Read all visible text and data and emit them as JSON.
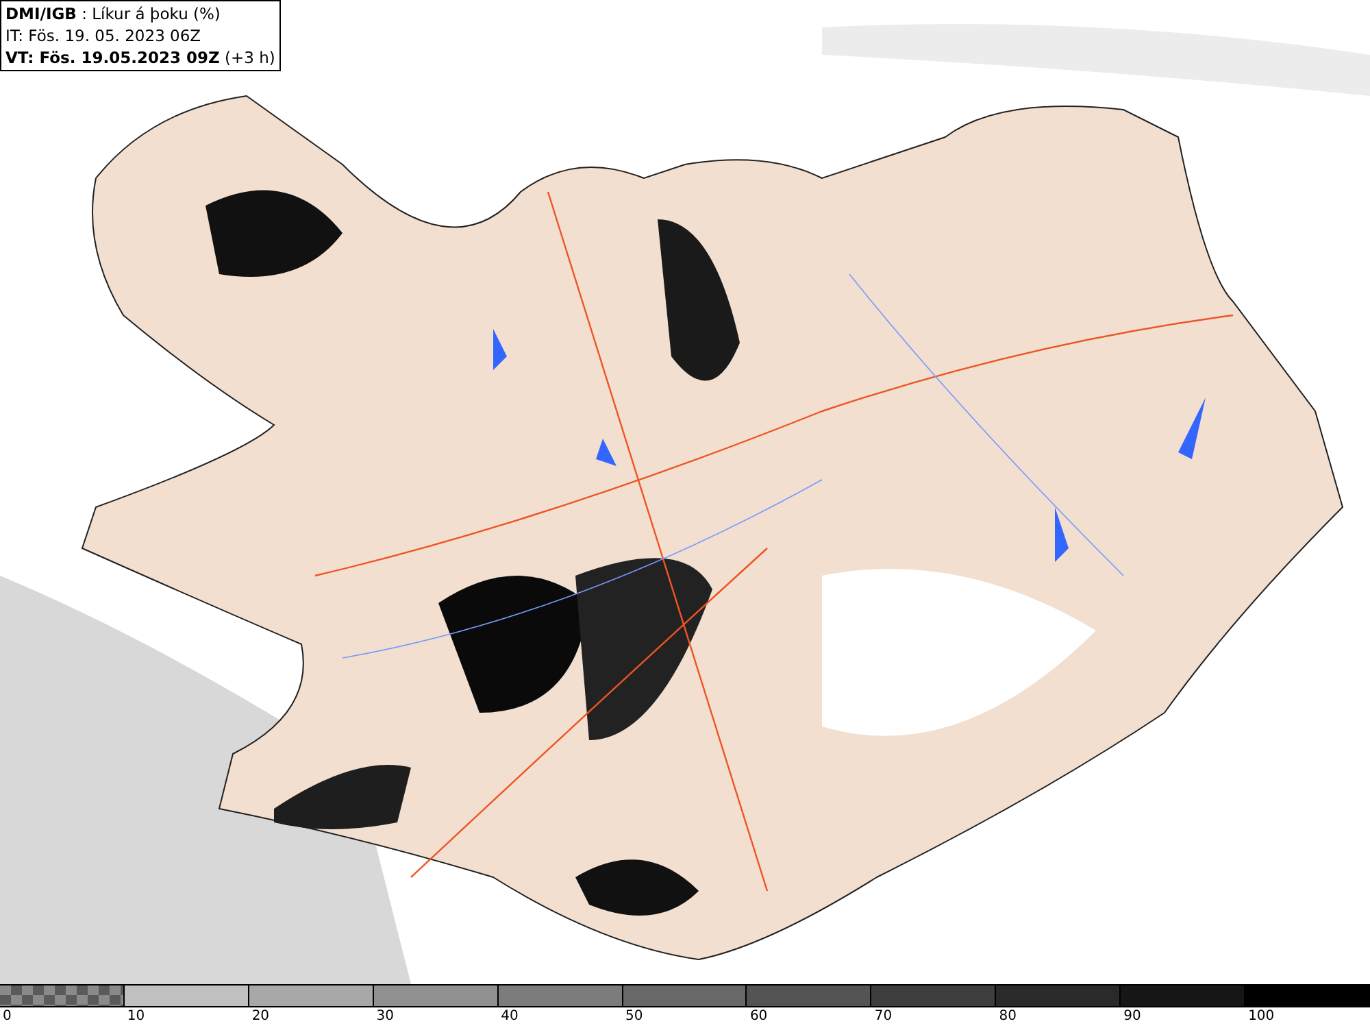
{
  "header": {
    "lines": [
      "**DMI/IGB** : Líkur á þoku (%)",
      "IT: Fös. 19. 05. 2023 06Z",
      "**VT: Fös. 19.05.2023 09Z** (+3 h)"
    ]
  },
  "legend": {
    "segments": [
      {
        "kind": "checker",
        "color": "#5a5a5a",
        "label": "0"
      },
      {
        "kind": "solid",
        "color": "#c0c0c0",
        "label": "10"
      },
      {
        "kind": "solid",
        "color": "#a8a8a8",
        "label": "20"
      },
      {
        "kind": "solid",
        "color": "#909090",
        "label": "30"
      },
      {
        "kind": "solid",
        "color": "#7c7c7c",
        "label": "40"
      },
      {
        "kind": "solid",
        "color": "#686868",
        "label": "50"
      },
      {
        "kind": "solid",
        "color": "#545454",
        "label": "60"
      },
      {
        "kind": "solid",
        "color": "#3e3e3e",
        "label": "70"
      },
      {
        "kind": "solid",
        "color": "#2a2a2a",
        "label": "80"
      },
      {
        "kind": "solid",
        "color": "#161616",
        "label": "90"
      },
      {
        "kind": "solid",
        "color": "#000000",
        "label": "100"
      }
    ]
  }
}
